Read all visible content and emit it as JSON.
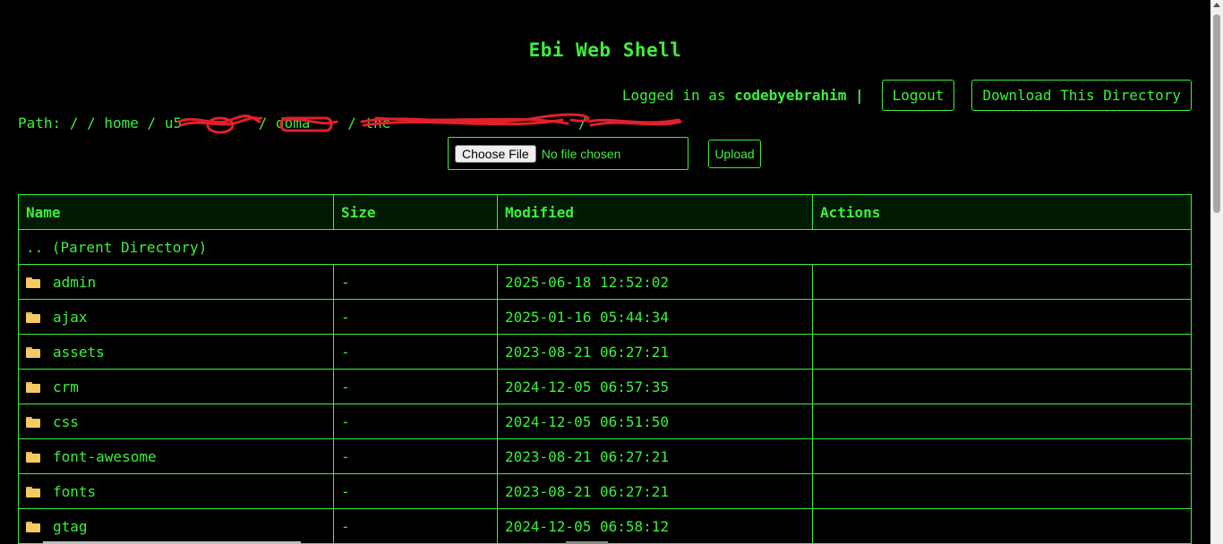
{
  "app": {
    "title": "Ebi Web Shell"
  },
  "header": {
    "logged_prefix": "Logged in as",
    "username": "codebyebrahim",
    "separator": "|",
    "logout_label": "Logout",
    "download_label": "Download This Directory"
  },
  "path": {
    "label": "Path:",
    "segments": [
      "/",
      "/",
      "home",
      "/",
      "u5",
      "/",
      "doma",
      "/",
      "the",
      "/",
      ""
    ]
  },
  "upload": {
    "choose_label": "Choose File",
    "no_file": "No file chosen",
    "upload_label": "Upload"
  },
  "table": {
    "headers": [
      "Name",
      "Size",
      "Modified",
      "Actions"
    ],
    "parent": ".. (Parent Directory)",
    "rows": [
      {
        "name": "admin",
        "size": "-",
        "modified": "2025-06-18 12:52:02",
        "actions": ""
      },
      {
        "name": "ajax",
        "size": "-",
        "modified": "2025-01-16 05:44:34",
        "actions": ""
      },
      {
        "name": "assets",
        "size": "-",
        "modified": "2023-08-21 06:27:21",
        "actions": ""
      },
      {
        "name": "crm",
        "size": "-",
        "modified": "2024-12-05 06:57:35",
        "actions": ""
      },
      {
        "name": "css",
        "size": "-",
        "modified": "2024-12-05 06:51:50",
        "actions": ""
      },
      {
        "name": "font-awesome",
        "size": "-",
        "modified": "2023-08-21 06:27:21",
        "actions": ""
      },
      {
        "name": "fonts",
        "size": "-",
        "modified": "2023-08-21 06:27:21",
        "actions": ""
      },
      {
        "name": "gtag",
        "size": "-",
        "modified": "2024-12-05 06:58:12",
        "actions": ""
      }
    ]
  },
  "colors": {
    "accent": "#3cf03c",
    "background": "#000000",
    "redaction": "#e0202a",
    "folder": "#f4cb63"
  }
}
